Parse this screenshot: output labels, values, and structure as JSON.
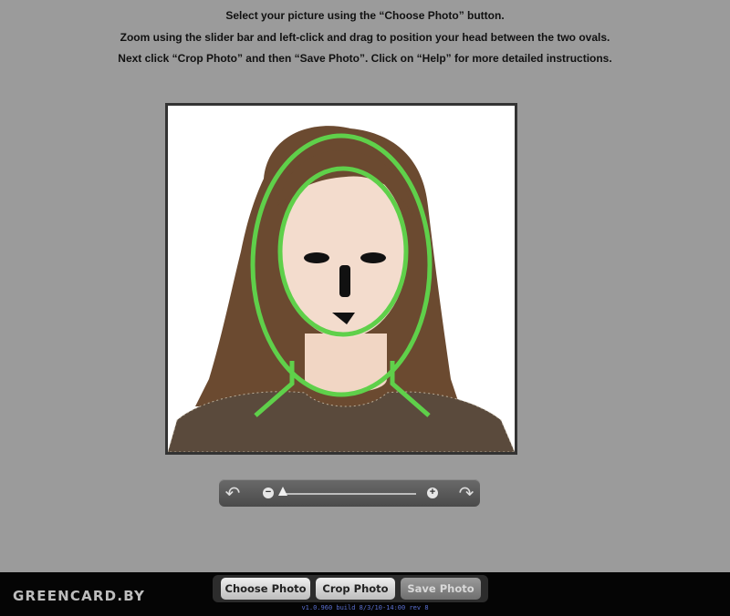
{
  "instructions": {
    "line1": "Select your picture using the “Choose Photo” button.",
    "line2": "Zoom using the slider bar and left-click and drag to position your head between the two ovals.",
    "line3": "Next click “Crop Photo” and then “Save Photo”.  Click on “Help” for more detailed instructions."
  },
  "zoom": {
    "rotate_left_icon": "rotate-left-icon",
    "rotate_right_icon": "rotate-right-icon",
    "minus_symbol": "−",
    "plus_symbol": "+",
    "level": 0.0
  },
  "guide": {
    "color": "#5fd04a"
  },
  "footer": {
    "brand": "GREENCARD.BY",
    "choose_label": "Choose Photo",
    "crop_label": "Crop Photo",
    "save_label": "Save Photo",
    "version": "v1.0.960 build 8/3/10-14:00 rev 8"
  }
}
